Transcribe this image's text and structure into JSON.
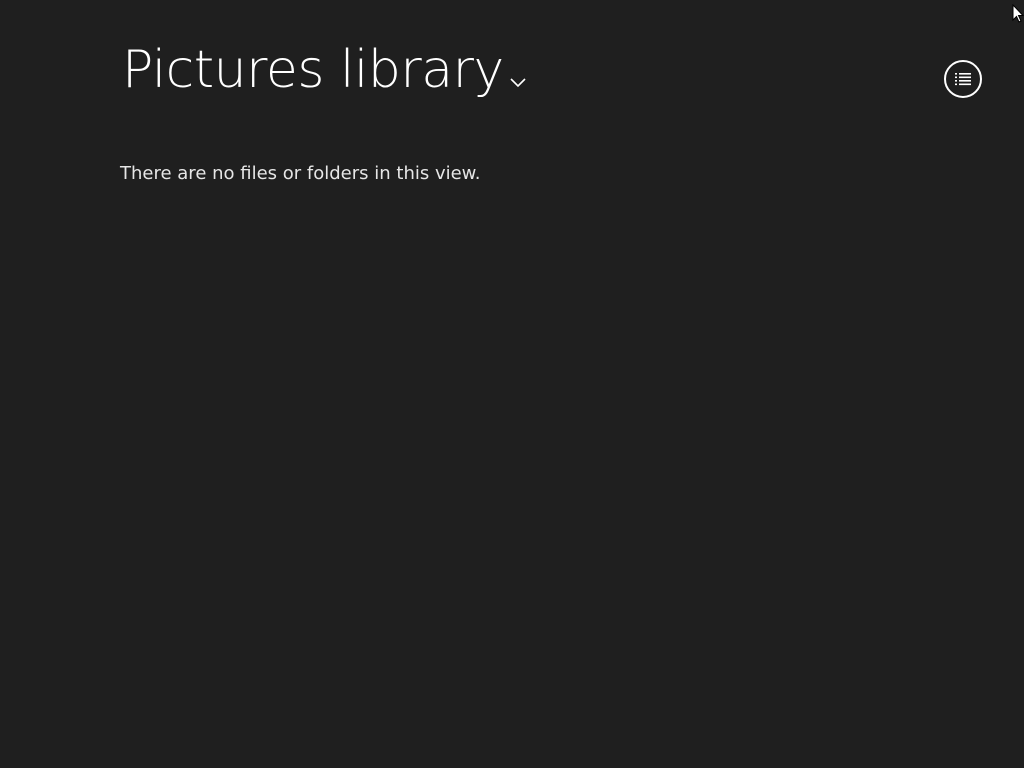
{
  "header": {
    "title": "Pictures library",
    "chevron_icon": "chevron-down-icon"
  },
  "main": {
    "empty_message": "There are no files or folders in this view."
  },
  "toolbar": {
    "view_button_icon": "list-view-icon"
  },
  "colors": {
    "background": "#1f1f1f",
    "foreground": "#ffffff"
  }
}
